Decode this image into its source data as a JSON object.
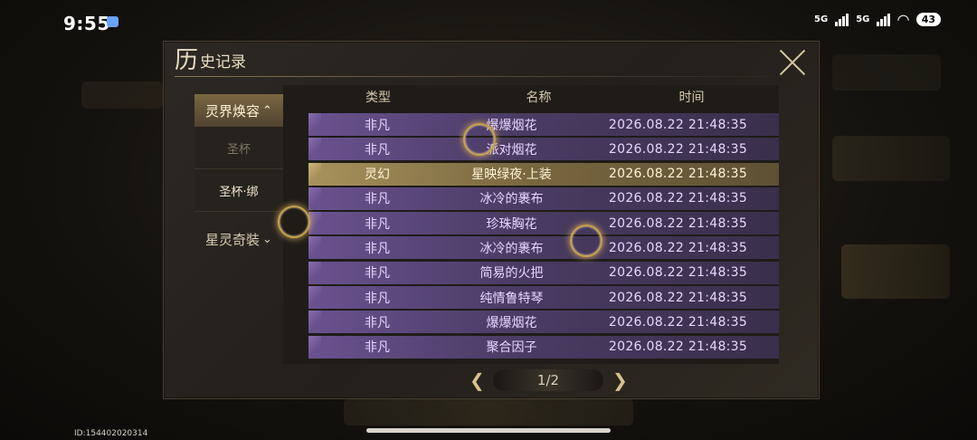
{
  "status": {
    "time": "9:55",
    "net1": "5G",
    "net2": "5G",
    "battery": "43"
  },
  "dialog": {
    "title_big": "历",
    "title_rest": "史记录",
    "close_label": "close"
  },
  "sidebar": {
    "categories": [
      {
        "label": "灵界焕容",
        "chevron": "^",
        "subs": [
          "圣杯",
          "圣杯·绑"
        ]
      },
      {
        "label": "星灵奇裝",
        "chevron": "v"
      }
    ]
  },
  "table": {
    "headers": {
      "type": "类型",
      "name": "名称",
      "time": "时间"
    },
    "rows": [
      {
        "type": "非凡",
        "name": "爆爆烟花",
        "time": "2026.08.22 21:48:35"
      },
      {
        "type": "非凡",
        "name": "派对烟花",
        "time": "2026.08.22 21:48:35"
      },
      {
        "type": "灵幻",
        "name": "星映绿夜·上装",
        "time": "2026.08.22 21:48:35"
      },
      {
        "type": "非凡",
        "name": "冰冷的裹布",
        "time": "2026.08.22 21:48:35"
      },
      {
        "type": "非凡",
        "name": "珍珠胸花",
        "time": "2026.08.22 21:48:35"
      },
      {
        "type": "非凡",
        "name": "冰冷的裹布",
        "time": "2026.08.22 21:48:35"
      },
      {
        "type": "非凡",
        "name": "简易的火把",
        "time": "2026.08.22 21:48:35"
      },
      {
        "type": "非凡",
        "name": "纯情鲁特琴",
        "time": "2026.08.22 21:48:35"
      },
      {
        "type": "非凡",
        "name": "爆爆烟花",
        "time": "2026.08.22 21:48:35"
      },
      {
        "type": "非凡",
        "name": "聚合因子",
        "time": "2026.08.22 21:48:35"
      }
    ]
  },
  "pager": {
    "prev": "❮",
    "page": "1/2",
    "next": "❯"
  },
  "footer": {
    "id_text": "ID:154402020314"
  },
  "colors": {
    "rare_row": "#6a5290",
    "legendary_row": "#a8925c",
    "accent_gold": "#c9a24c"
  }
}
